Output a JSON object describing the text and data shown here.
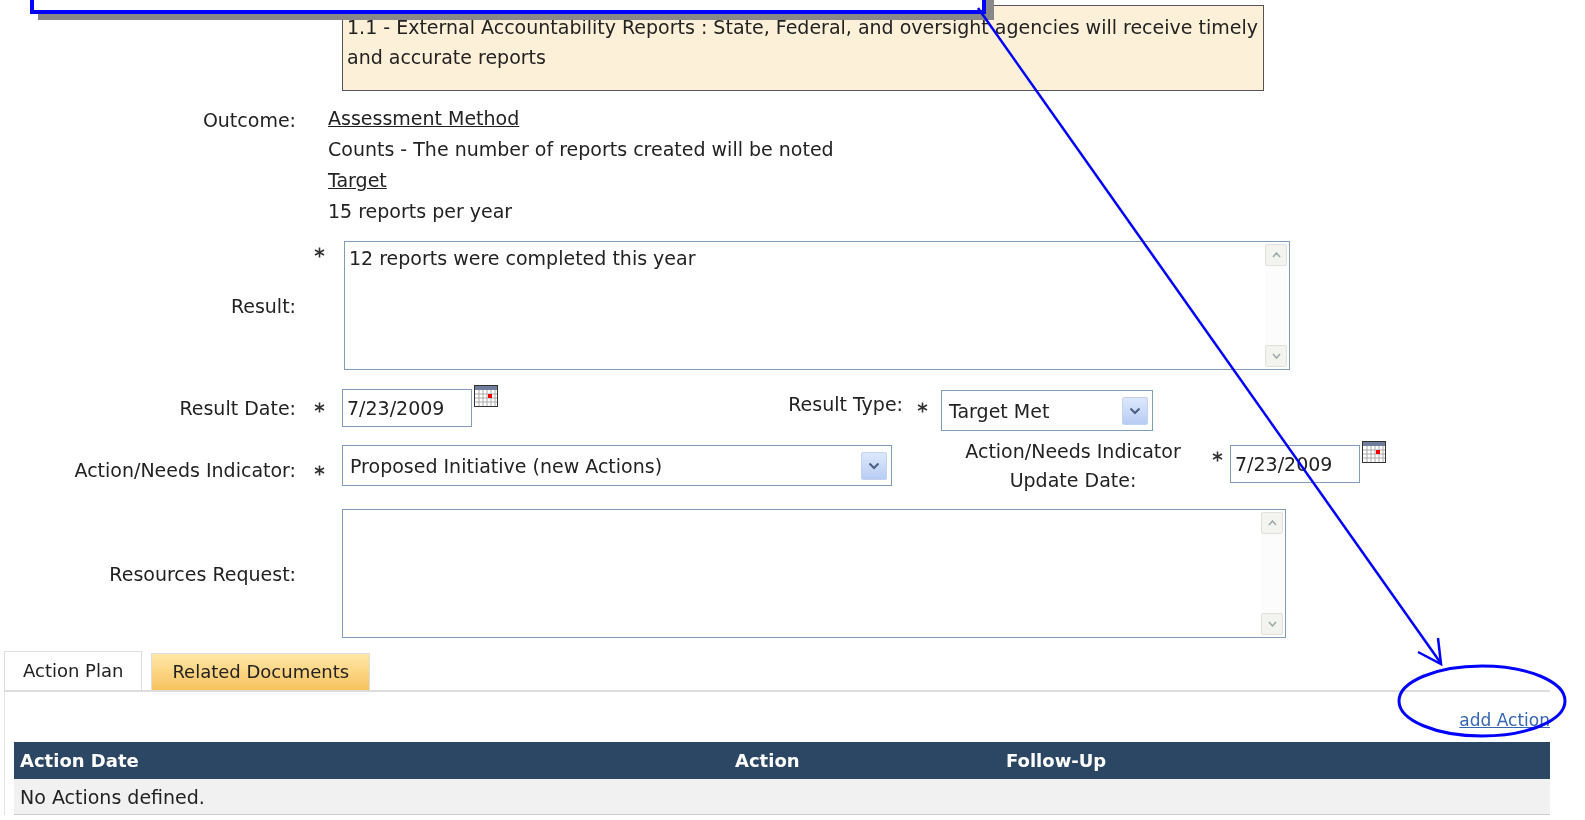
{
  "goal_text": "1.1 - External Accountability Reports : State, Federal, and oversight agencies will receive timely and accurate reports",
  "outcome": {
    "label": "Outcome:",
    "assessment_heading": "Assessment Method",
    "assessment": "Counts - The number of reports created will be noted",
    "target_heading": "Target",
    "target": "15 reports per year"
  },
  "result": {
    "label": "Result:",
    "required": true,
    "value": "12 reports were completed this year"
  },
  "result_date": {
    "label": "Result Date:",
    "required": true,
    "value": "7/23/2009"
  },
  "result_type": {
    "label": "Result Type:",
    "required": true,
    "value": "Target Met"
  },
  "action_needs": {
    "label": "Action/Needs Indicator:",
    "required": true,
    "value": "Proposed Initiative (new Actions)"
  },
  "action_update_date": {
    "label": "Action/Needs Indicator Update Date:",
    "required": true,
    "value": "7/23/2009"
  },
  "resources": {
    "label": "Resources Request:",
    "required": false
  },
  "tabs": [
    {
      "label": "Action Plan",
      "selected": true
    },
    {
      "label": "Related Documents",
      "selected": false
    }
  ],
  "add_link": "add Action",
  "table": {
    "columns": [
      "Action Date",
      "Action",
      "Follow-Up"
    ],
    "empty_message": "No Actions defined."
  }
}
